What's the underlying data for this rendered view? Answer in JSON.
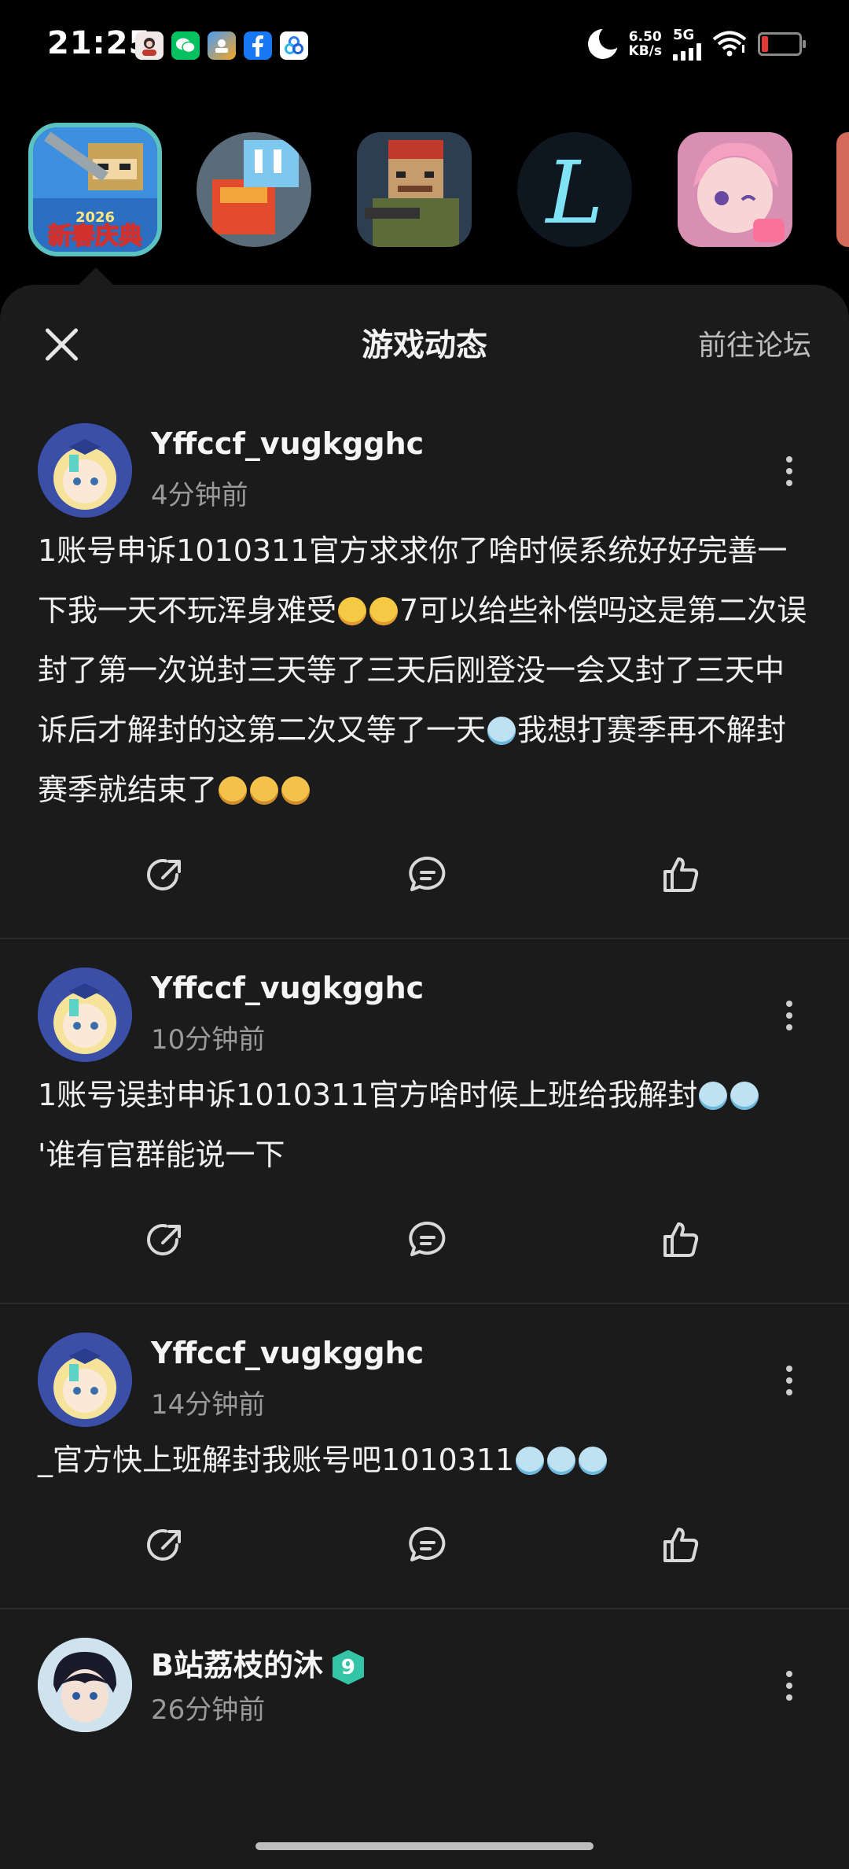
{
  "status_bar": {
    "time": "21:25",
    "net_speed_value": "6.50",
    "net_speed_unit": "KB/s",
    "network": "5G",
    "notification_icons": [
      "avatar-app-icon",
      "wechat-icon",
      "photo-app-icon",
      "facebook-icon",
      "tencent-icon"
    ]
  },
  "games": [
    {
      "name": "game-icon-mini-world-festival",
      "label": "新春庆典",
      "sublabel": "2026",
      "selected": true
    },
    {
      "name": "game-icon-block-hero"
    },
    {
      "name": "game-icon-pixel-soldier"
    },
    {
      "name": "game-icon-letter-l"
    },
    {
      "name": "game-icon-anime-girl"
    }
  ],
  "sheet": {
    "title": "游戏动态",
    "forum_link": "前往论坛"
  },
  "posts": [
    {
      "username": "Yffccf_vugkgghc",
      "time": "4分钟前",
      "text_1": "1账号申诉1010311官方求求你了啥时候系统好好完善一下我一天不玩浑身难受",
      "text_2": "7可以给些补偿吗这是第二次误封了第一次说封三天等了三天后刚登没一会又封了三天中诉后才解封的这第二次又等了一天",
      "text_3": "我想打赛季再不解封赛季就结束了"
    },
    {
      "username": "Yffccf_vugkgghc",
      "time": "10分钟前",
      "text_1": "1账号误封申诉1010311官方啥时候上班给我解封",
      "text_2": "'谁有官群能说一下"
    },
    {
      "username": "Yffccf_vugkgghc",
      "time": "14分钟前",
      "text_1": "_官方快上班解封我账号吧1010311"
    },
    {
      "username": "B站荔枝的沐",
      "time": "26分钟前",
      "level": "9"
    }
  ],
  "colors": {
    "background": "#000000",
    "sheet": "#1b1b1b",
    "accent": "#5bc2c2",
    "badge": "#33c5a6"
  }
}
